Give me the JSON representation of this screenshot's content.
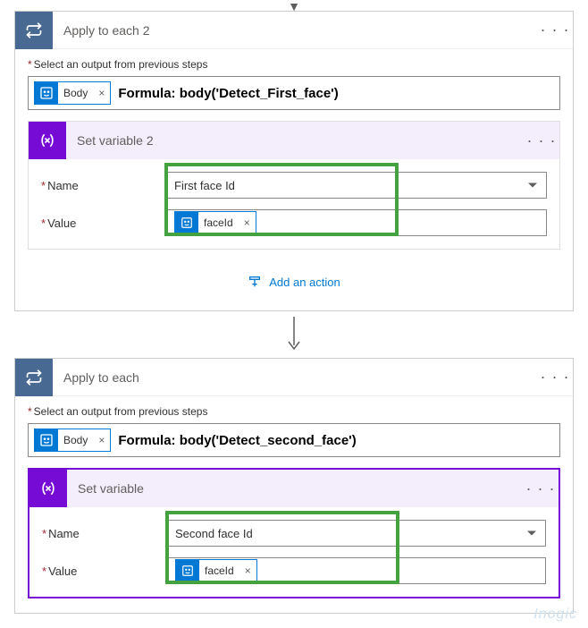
{
  "card1": {
    "title": "Apply to each 2",
    "select_label": "Select an output from previous steps",
    "token_label": "Body",
    "formula": "Formula:  body('Detect_First_face')",
    "nested": {
      "title": "Set variable 2",
      "name_label": "Name",
      "name_value": "First face Id",
      "value_label": "Value",
      "value_token": "faceId"
    },
    "add_action": "Add an action"
  },
  "card2": {
    "title": "Apply to each",
    "select_label": "Select an output from previous steps",
    "token_label": "Body",
    "formula": "Formula:  body('Detect_second_face')",
    "nested": {
      "title": "Set variable",
      "name_label": "Name",
      "name_value": "Second face Id",
      "value_label": "Value",
      "value_token": "faceId"
    }
  },
  "watermark": "Inogic"
}
